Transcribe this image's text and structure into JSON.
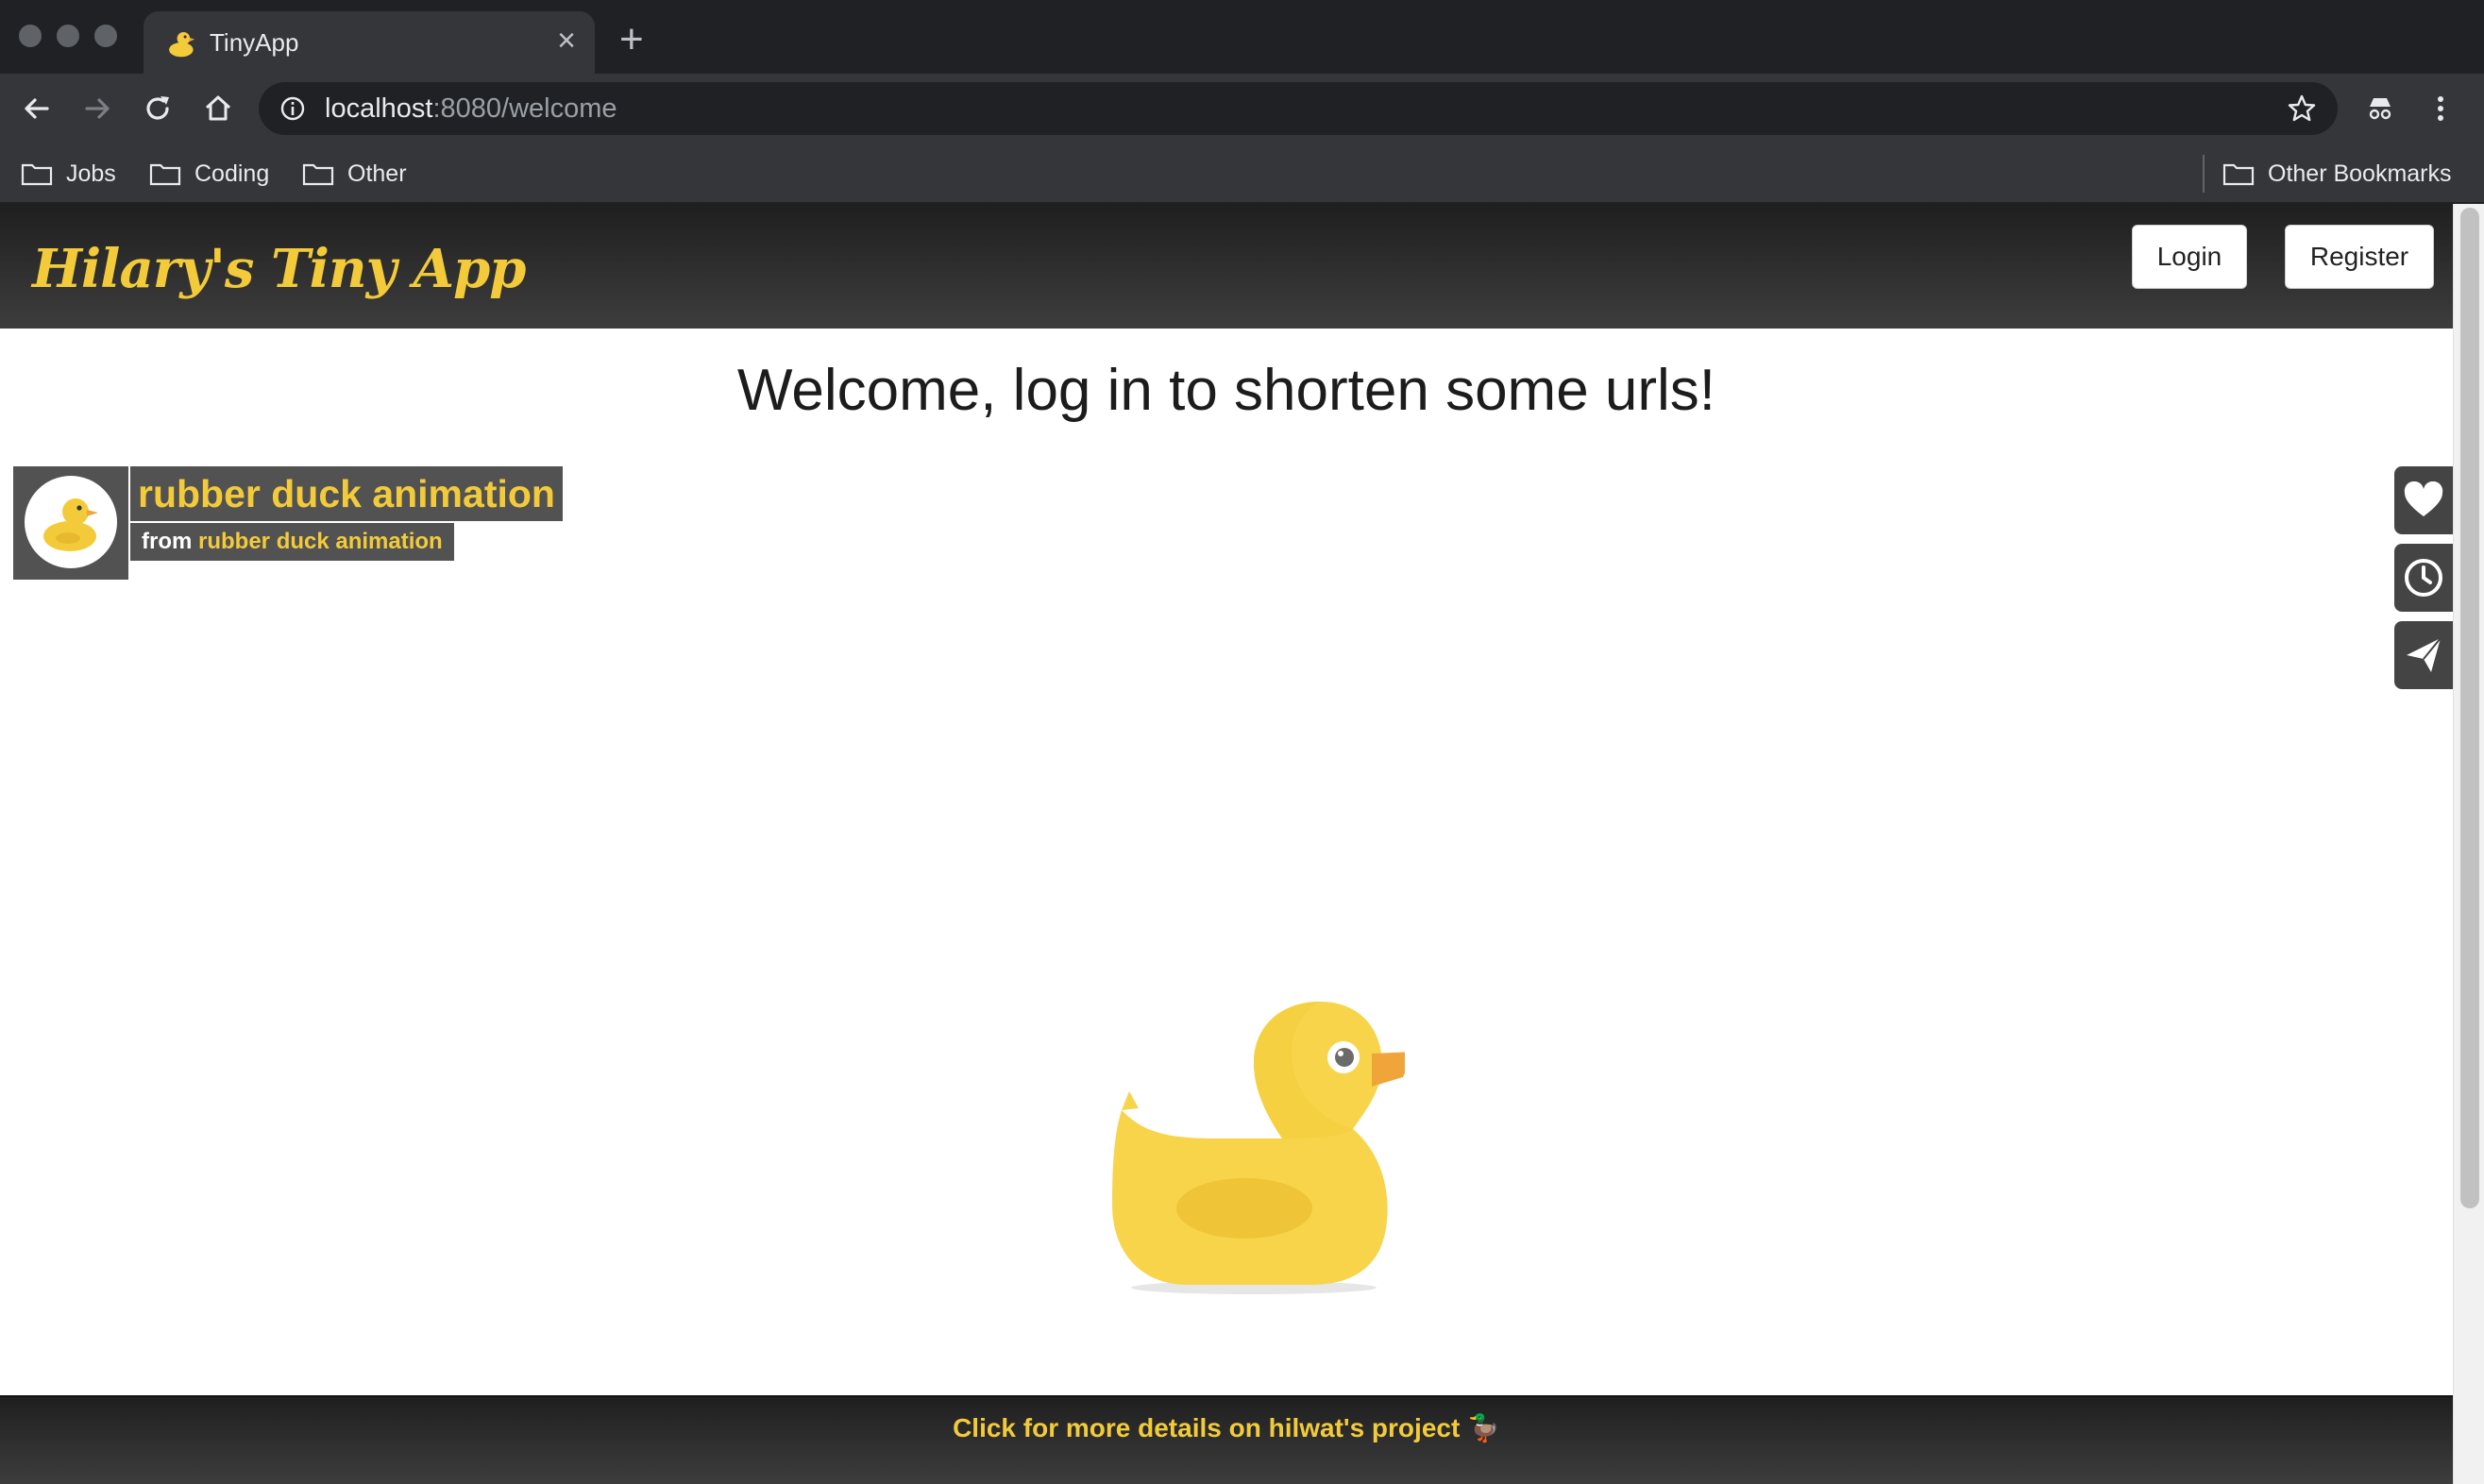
{
  "browser": {
    "tab_title": "TinyApp",
    "tab_favicon": "duck-icon",
    "url_host": "localhost",
    "url_rest": ":8080/welcome",
    "bookmarks": [
      {
        "label": "Jobs"
      },
      {
        "label": "Coding"
      },
      {
        "label": "Other"
      }
    ],
    "other_bookmarks": "Other Bookmarks"
  },
  "header": {
    "brand": "Hilary's Tiny App",
    "login_label": "Login",
    "register_label": "Register"
  },
  "main": {
    "heading": "Welcome, log in to shorten some urls!",
    "embed": {
      "title": "rubber duck animation",
      "from_prefix": "from",
      "from_link": "rubber duck animation"
    },
    "side_buttons": [
      "heart-icon",
      "clock-icon",
      "send-icon"
    ]
  },
  "footer": {
    "link": "Click for more details on hilwat's project 🦆"
  },
  "colors": {
    "brand_yellow": "#f3cb3a",
    "header_dark": "#2b2b2b",
    "chrome_dark": "#35363a"
  }
}
